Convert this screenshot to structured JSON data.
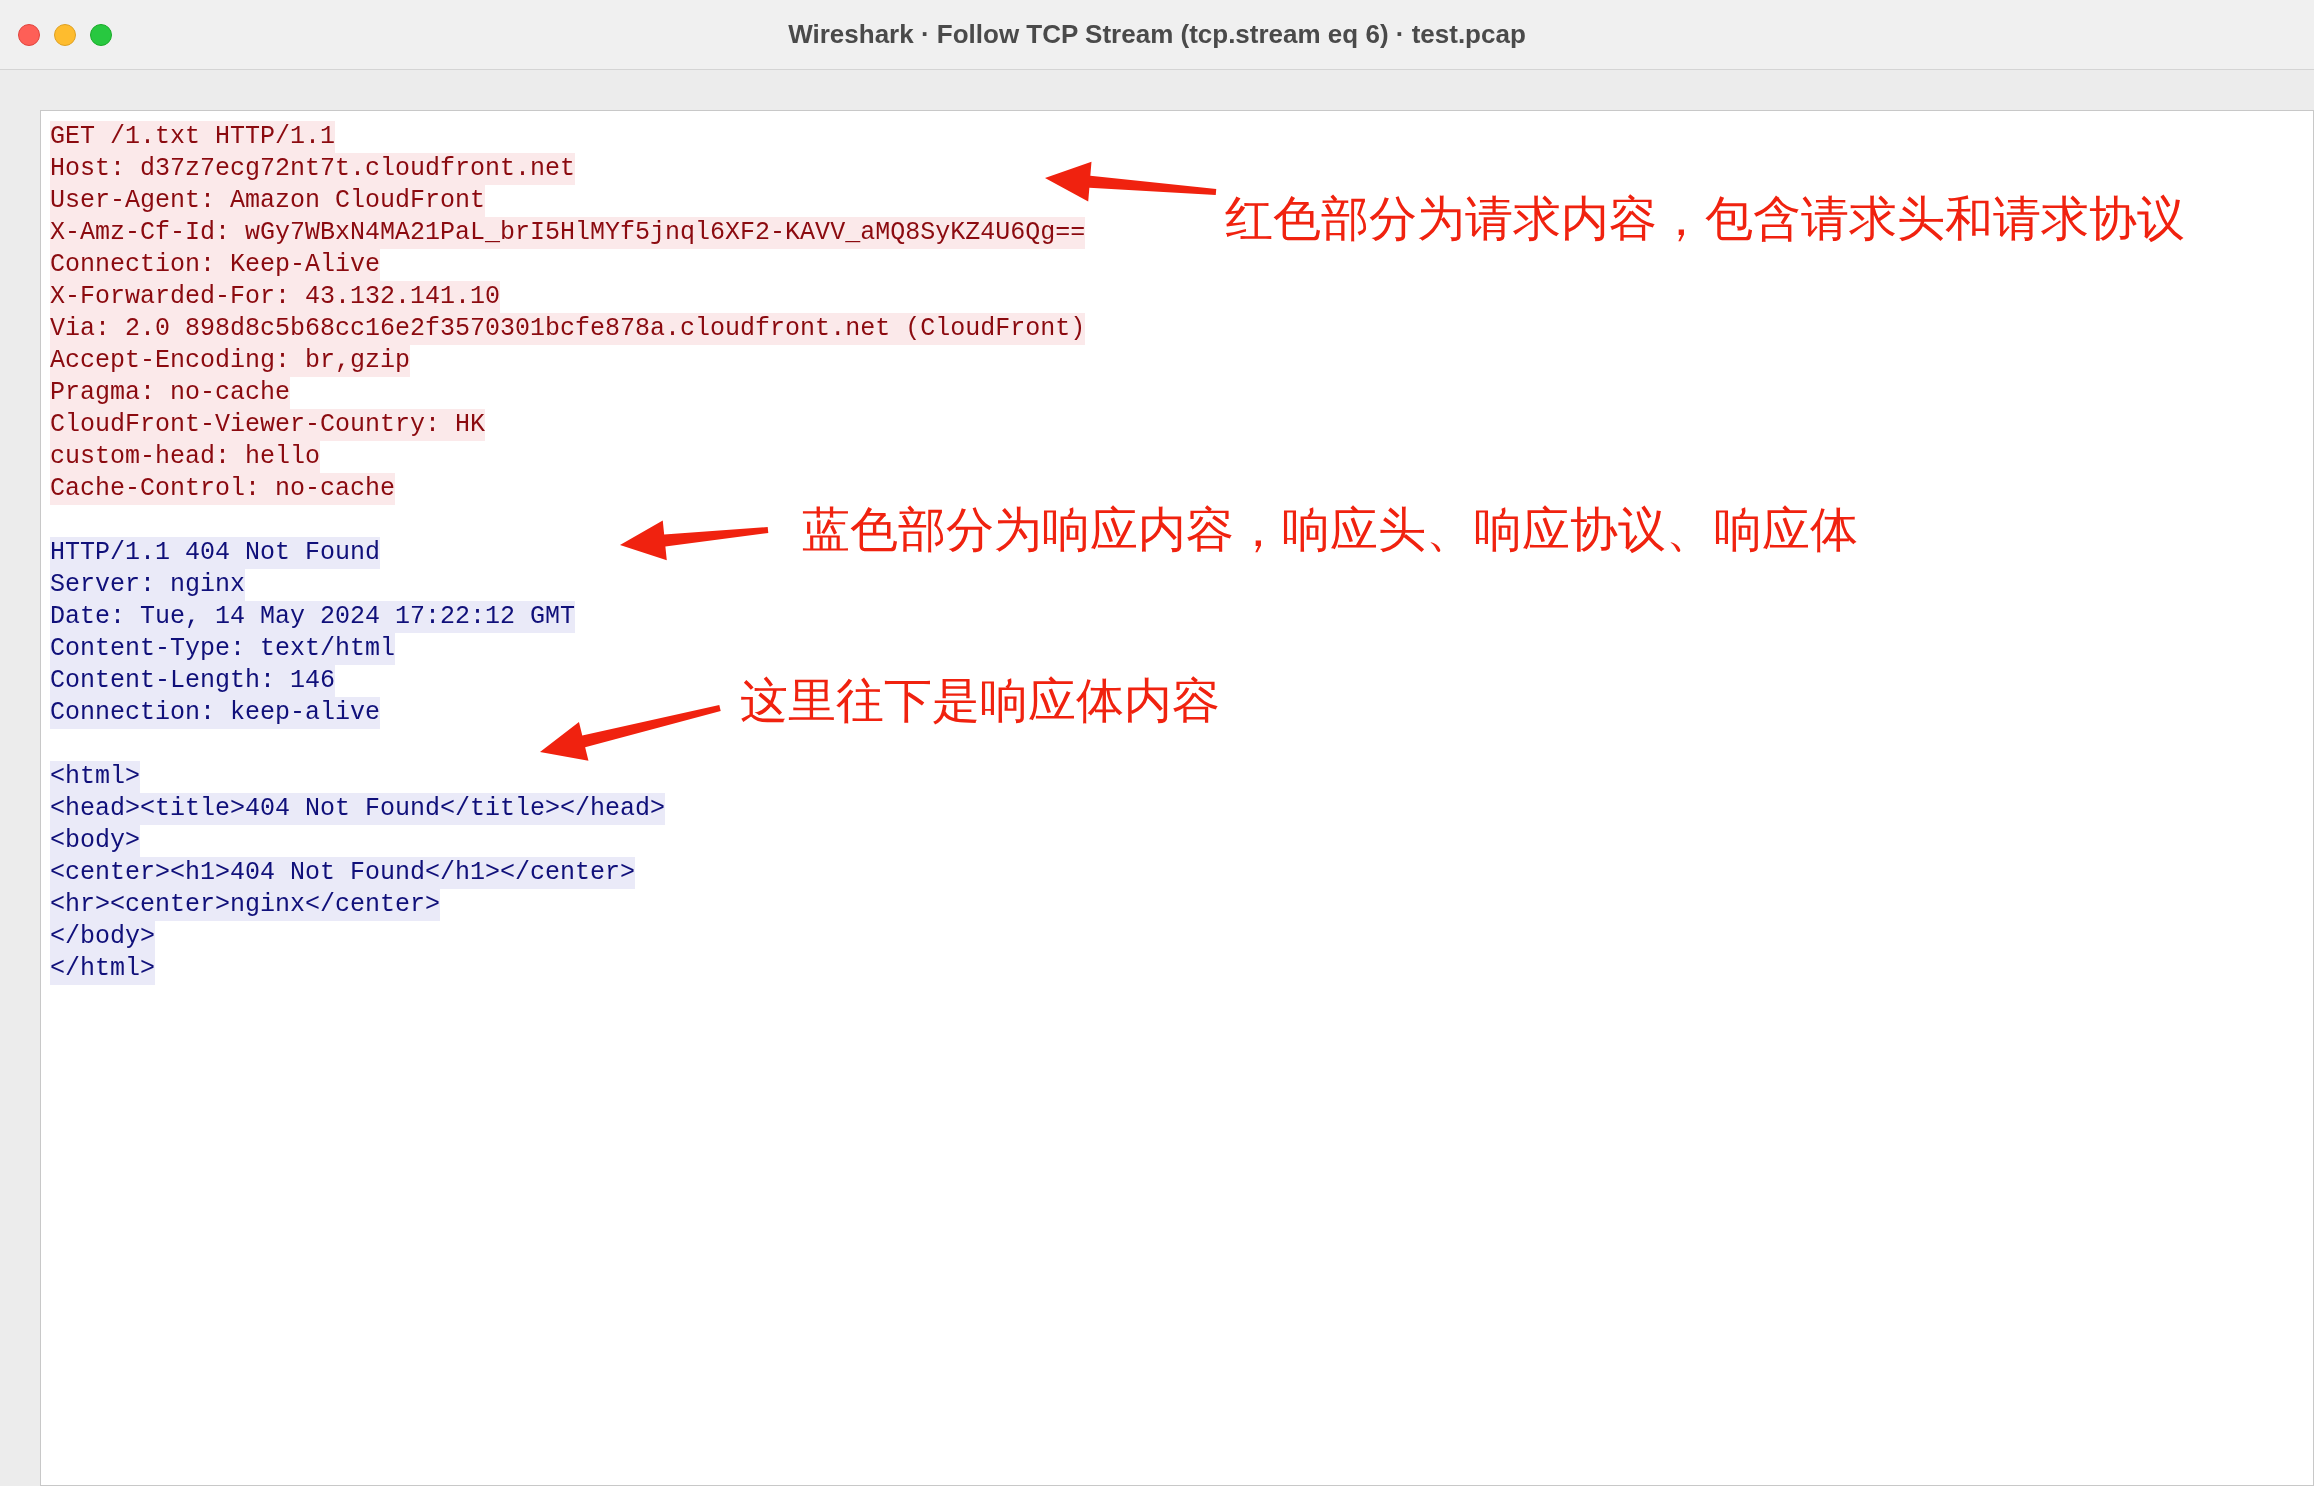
{
  "window": {
    "title": "Wireshark · Follow TCP Stream (tcp.stream eq 6) · test.pcap"
  },
  "stream": [
    {
      "kind": "request",
      "lines": [
        "GET /1.txt HTTP/1.1",
        "Host: d37z7ecg72nt7t.cloudfront.net",
        "User-Agent: Amazon CloudFront",
        "X-Amz-Cf-Id: wGy7WBxN4MA21PaL_brI5HlMYf5jnql6XF2-KAVV_aMQ8SyKZ4U6Qg==",
        "Connection: Keep-Alive",
        "X-Forwarded-For: 43.132.141.10",
        "Via: 2.0 898d8c5b68cc16e2f3570301bcfe878a.cloudfront.net (CloudFront)",
        "Accept-Encoding: br,gzip",
        "Pragma: no-cache",
        "CloudFront-Viewer-Country: HK",
        "custom-head: hello",
        "Cache-Control: no-cache"
      ]
    },
    {
      "kind": "response",
      "lines": [
        "HTTP/1.1 404 Not Found",
        "Server: nginx",
        "Date: Tue, 14 May 2024 17:22:12 GMT",
        "Content-Type: text/html",
        "Content-Length: 146",
        "Connection: keep-alive"
      ]
    },
    {
      "kind": "response",
      "lines": [
        "<html>",
        "<head><title>404 Not Found</title></head>",
        "<body>",
        "<center><h1>404 Not Found</h1></center>",
        "<hr><center>nginx</center>",
        "</body>",
        "</html>"
      ]
    }
  ],
  "annotations": [
    "红色部分为请求内容，包含请求头和请求协议",
    "蓝色部分为响应内容，响应头、响应协议、响应体",
    "这里往下是响应体内容"
  ]
}
